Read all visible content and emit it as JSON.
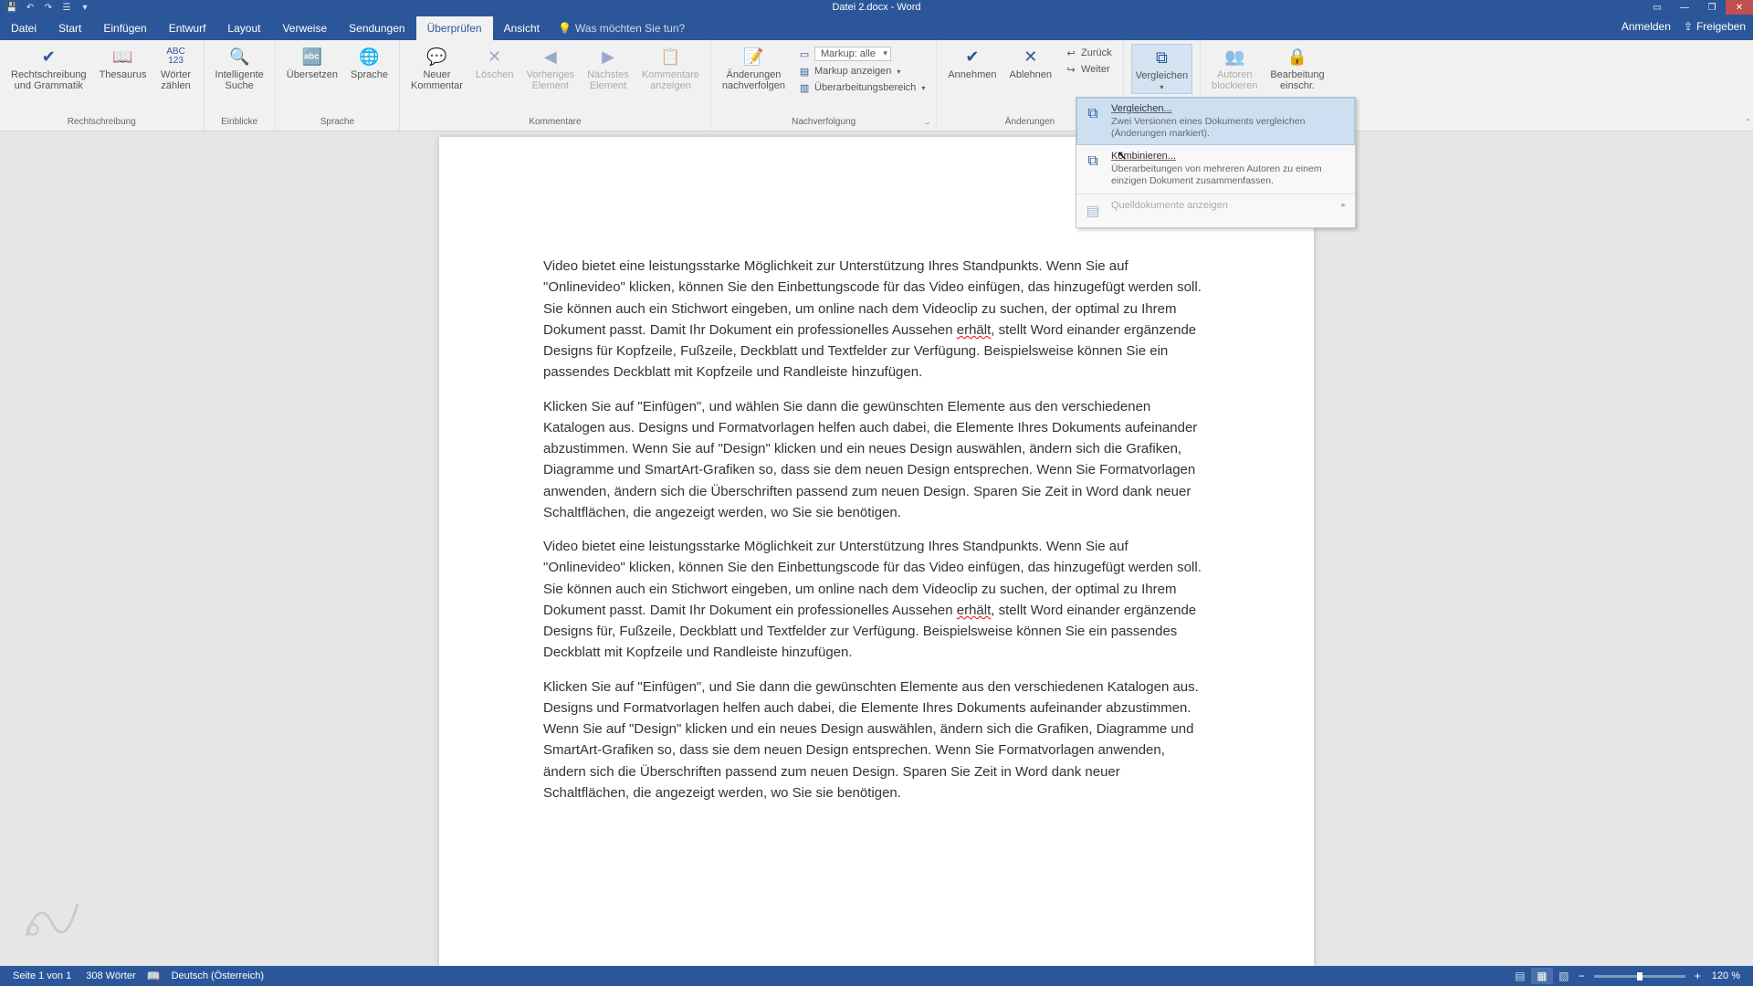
{
  "titlebar": {
    "doc_title": "Datei 2.docx - Word"
  },
  "tabs": {
    "file": "Datei",
    "home": "Start",
    "insert": "Einfügen",
    "draft": "Entwurf",
    "layout": "Layout",
    "references": "Verweise",
    "mailings": "Sendungen",
    "review": "Überprüfen",
    "view": "Ansicht",
    "tellme_placeholder": "Was möchten Sie tun?",
    "signin": "Anmelden",
    "share": "Freigeben"
  },
  "ribbon": {
    "proofing": {
      "spelling": "Rechtschreibung\nund Grammatik",
      "thesaurus": "Thesaurus",
      "wordcount": "Wörter\nzählen",
      "label": "Rechtschreibung"
    },
    "language": {
      "smart": "Intelligente\nSuche",
      "translate": "Übersetzen",
      "lang": "Sprache",
      "insights_label": "Einblicke",
      "label": "Sprache"
    },
    "comments": {
      "new": "Neuer\nKommentar",
      "delete": "Löschen",
      "prev": "Vorheriges\nElement",
      "next": "Nächstes\nElement",
      "show": "Kommentare\nanzeigen",
      "label": "Kommentare"
    },
    "tracking": {
      "track": "Änderungen\nnachverfolgen",
      "markup_display_icon": "▭",
      "markup_label": "Markup: alle",
      "show_markup": "Markup anzeigen",
      "reviewing_pane": "Überarbeitungsbereich",
      "label": "Nachverfolgung"
    },
    "changes": {
      "accept": "Annehmen",
      "reject": "Ablehnen",
      "back": "Zurück",
      "forward": "Weiter",
      "label": "Änderungen"
    },
    "compare": {
      "compare": "Vergleichen"
    },
    "protect": {
      "block": "Autoren\nblockieren",
      "restrict": "Bearbeitung\neinschr."
    }
  },
  "compare_menu": {
    "compare_title": "Vergleichen...",
    "compare_desc": "Zwei Versionen eines Dokuments vergleichen (Änderungen markiert).",
    "combine_title": "Kombinieren...",
    "combine_desc": "Überarbeitungen von mehreren Autoren zu einem einzigen Dokument zusammenfassen.",
    "show_source": "Quelldokumente anzeigen"
  },
  "document": {
    "p1": "Video bietet eine leistungsstarke Möglichkeit zur Unterstützung Ihres Standpunkts. Wenn Sie auf \"Onlinevideo\" klicken, können Sie den Einbettungscode für das Video einfügen, das hinzugefügt werden soll. Sie können auch ein Stichwort eingeben, um online nach dem Videoclip zu suchen, der optimal zu Ihrem Dokument passt. Damit Ihr Dokument ein professionelles Aussehen ",
    "p1_err": "erhält",
    "p1_end": ", stellt Word einander ergänzende Designs für Kopfzeile, Fußzeile, Deckblatt und Textfelder zur Verfügung. Beispielsweise können Sie ein passendes Deckblatt mit Kopfzeile und Randleiste hinzufügen.",
    "p2": "Klicken Sie auf \"Einfügen\", und wählen Sie dann die gewünschten Elemente aus den verschiedenen Katalogen aus. Designs und Formatvorlagen helfen auch dabei, die Elemente Ihres Dokuments aufeinander abzustimmen. Wenn Sie auf \"Design\" klicken und ein neues Design auswählen, ändern sich die Grafiken, Diagramme und SmartArt-Grafiken so, dass sie dem neuen Design entsprechen. Wenn Sie Formatvorlagen anwenden, ändern sich die Überschriften passend zum neuen Design. Sparen Sie Zeit in Word dank neuer Schaltflächen, die angezeigt werden, wo Sie sie benötigen.",
    "p3": "Video bietet eine leistungsstarke Möglichkeit zur Unterstützung Ihres Standpunkts. Wenn Sie auf \"Onlinevideo\" klicken, können Sie den Einbettungscode für das Video einfügen, das hinzugefügt werden soll. Sie können auch ein Stichwort eingeben, um online nach dem Videoclip zu suchen, der optimal zu Ihrem Dokument passt. Damit Ihr Dokument ein professionelles Aussehen ",
    "p3_err": "erhält",
    "p3_end": ", stellt Word einander ergänzende Designs für, Fußzeile, Deckblatt und Textfelder zur Verfügung. Beispielsweise können Sie ein passendes Deckblatt mit Kopfzeile und Randleiste hinzufügen.",
    "p4": "Klicken Sie auf \"Einfügen\", und Sie dann die gewünschten Elemente aus den verschiedenen Katalogen aus. Designs und Formatvorlagen helfen auch dabei, die Elemente Ihres Dokuments aufeinander abzustimmen. Wenn Sie auf \"Design\" klicken und ein neues Design auswählen, ändern sich die Grafiken, Diagramme und SmartArt-Grafiken so, dass sie dem neuen Design entsprechen. Wenn Sie Formatvorlagen anwenden, ändern sich die Überschriften passend zum neuen Design. Sparen Sie Zeit in Word dank neuer Schaltflächen, die angezeigt werden, wo Sie sie benötigen."
  },
  "statusbar": {
    "page": "Seite 1 von 1",
    "words": "308 Wörter",
    "lang": "Deutsch (Österreich)",
    "zoom": "120 %"
  }
}
